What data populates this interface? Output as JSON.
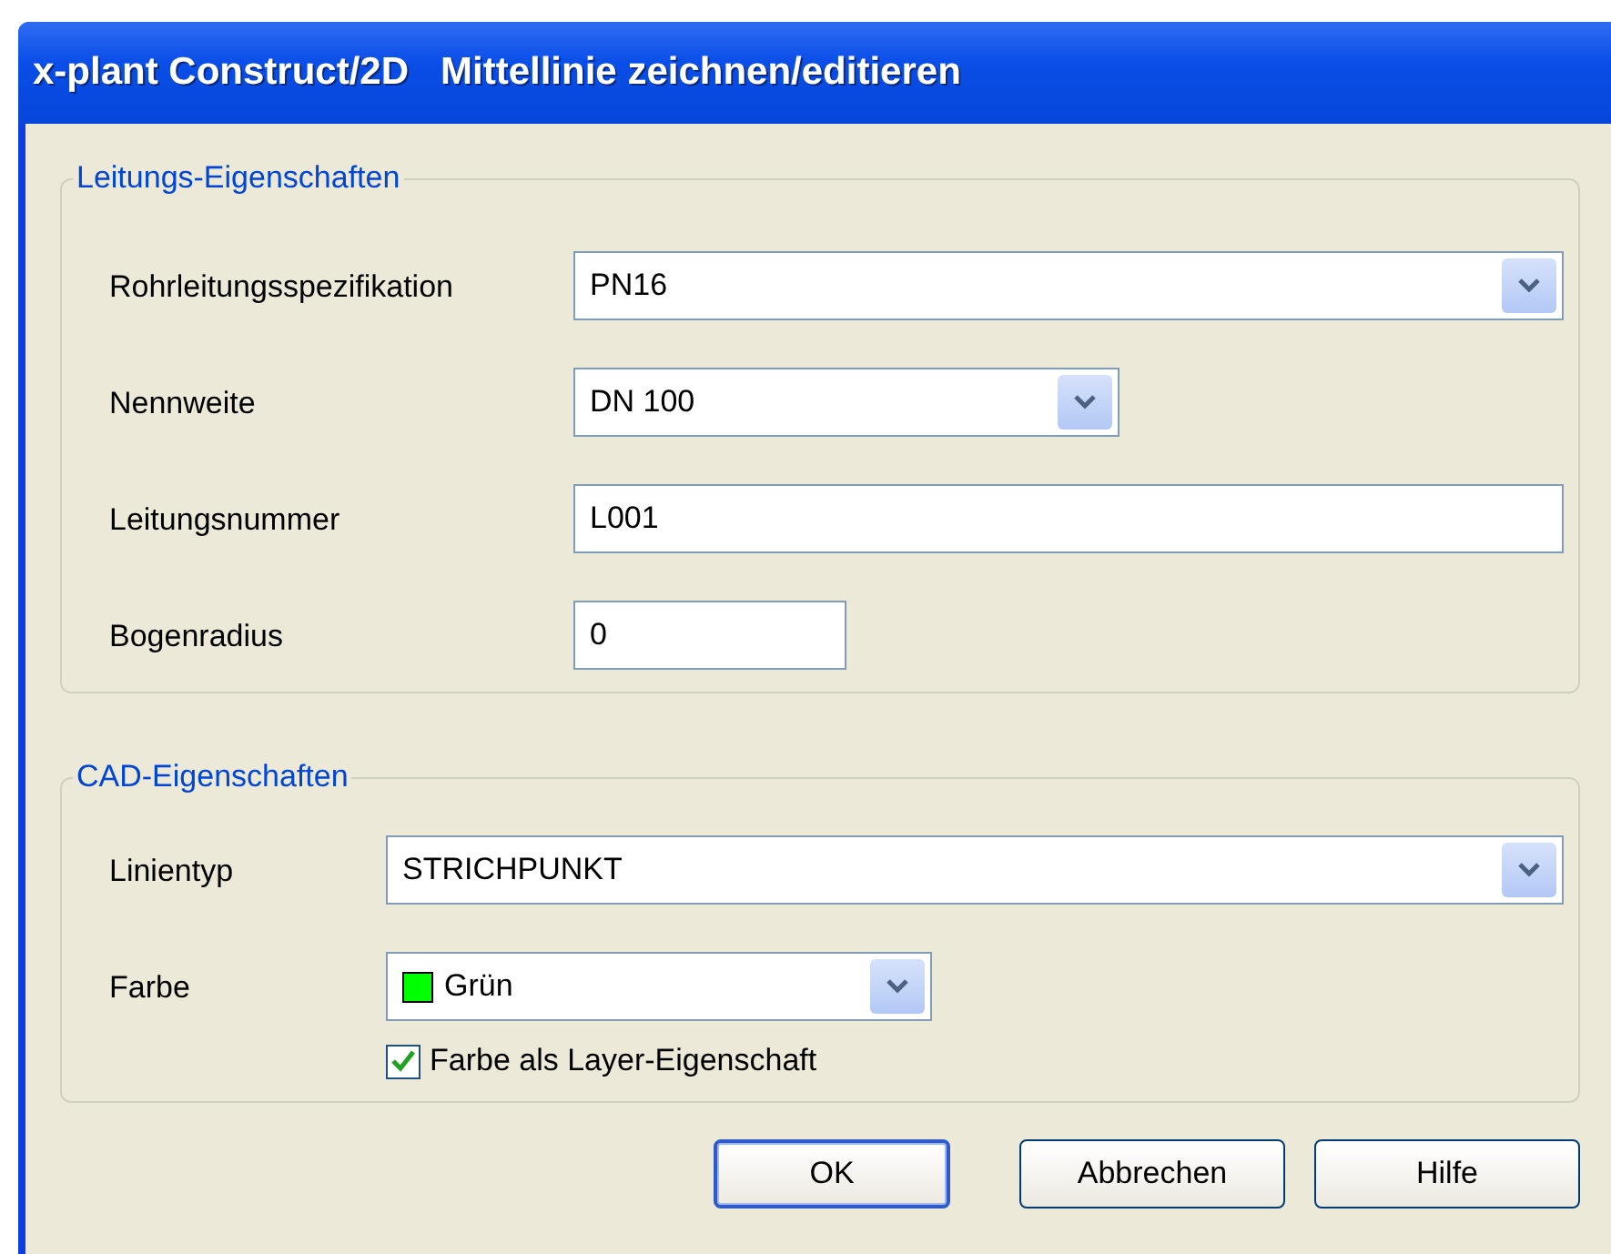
{
  "window": {
    "title": "x-plant Construct/2D   Mittellinie zeichnen/editieren"
  },
  "groups": [
    {
      "title": "Leitungs-Eigenschaften",
      "fields": [
        {
          "label": "Rohrleitungsspezifikation",
          "kind": "combo",
          "value": "PN16"
        },
        {
          "label": "Nennweite",
          "kind": "combo",
          "value": "DN 100"
        },
        {
          "label": "Leitungsnummer",
          "kind": "text",
          "value": "L001"
        },
        {
          "label": "Bogenradius",
          "kind": "text",
          "value": "0"
        }
      ]
    },
    {
      "title": "CAD-Eigenschaften",
      "fields": [
        {
          "label": "Linientyp",
          "kind": "combo",
          "value": "STRICHPUNKT"
        },
        {
          "label": "Farbe",
          "kind": "color",
          "value": "Grün",
          "color": "#00ff00",
          "checkbox": {
            "label": "Farbe als Layer-Eigenschaft",
            "checked": true
          }
        }
      ]
    }
  ],
  "buttons": [
    {
      "label": "OK",
      "default": true
    },
    {
      "label": "Abbrechen",
      "default": false
    },
    {
      "label": "Hilfe",
      "default": false
    }
  ]
}
